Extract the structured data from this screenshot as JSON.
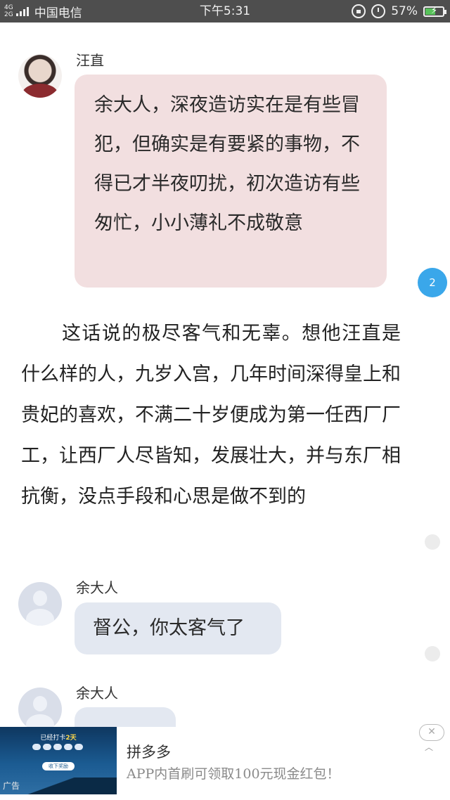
{
  "status_bar": {
    "network_top": "4G",
    "network_bottom": "2G",
    "carrier": "中国电信",
    "time": "下午5:31",
    "battery": "57%",
    "battery_level": 0.57,
    "icons": [
      "lock-icon",
      "alarm-icon",
      "battery-icon"
    ]
  },
  "messages": [
    {
      "speaker": "汪直",
      "avatar": "avatar-photo",
      "text": "余大人，深夜造访实在是有些冒犯，但确实是有要紧的事物，不得已才半夜叨扰，初次造访有些匆忙，小小薄礼不成敬意"
    },
    {
      "speaker": "余大人",
      "avatar": "avatar-default",
      "text": "督公，你太客气了"
    },
    {
      "speaker": "余大人",
      "avatar": "avatar-default",
      "text": ""
    }
  ],
  "narration": "这话说的极尽客气和无辜。想他汪直是什么样的人，九岁入宫，几年时间深得皇上和贵妃的喜欢，不满二十岁便成为第一任西厂厂工，让西厂人尽皆知，发展壮大，并与东厂相抗衡，没点手段和心思是做不到的",
  "floating_badge": "2",
  "ad": {
    "image_title_prefix": "已经打卡",
    "image_title_highlight": "2天",
    "image_button": "收下奖励",
    "tag": "广告",
    "title": "拼多多",
    "description": "APP内首刷可领取100元现金红包！",
    "close_symbol": "✕",
    "collapse_symbol": "︿"
  },
  "colors": {
    "status_bar": "#4e4e4e",
    "bubble_pink": "#f2dfe0",
    "bubble_blue": "#e3e8f1",
    "badge_blue": "#3aa7ea"
  }
}
